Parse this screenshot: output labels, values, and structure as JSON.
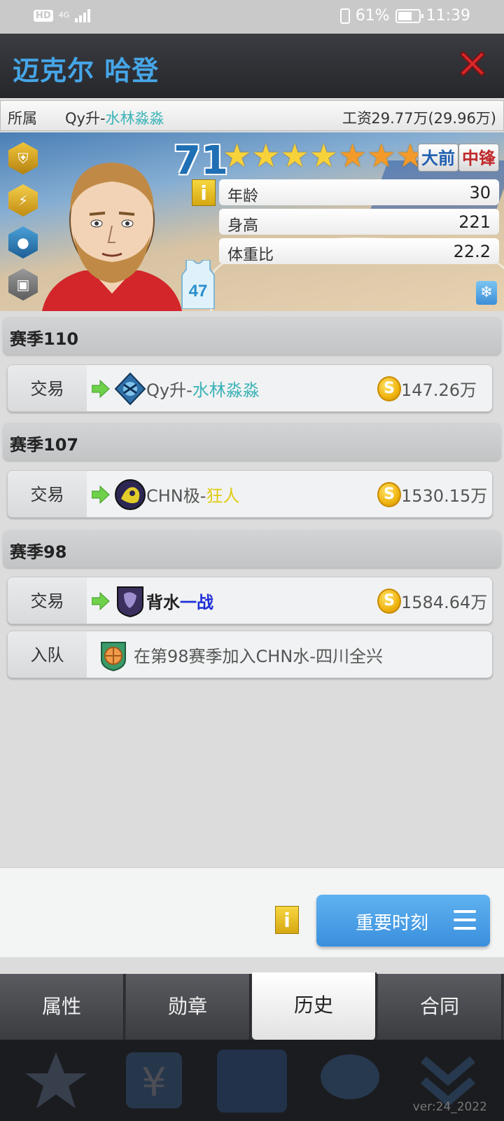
{
  "status_bar": {
    "hd": "HD",
    "network": "4G",
    "battery": "61%",
    "time": "11:39"
  },
  "header": {
    "player_name": "迈克尔 哈登"
  },
  "info_bar": {
    "team_label": "所属",
    "team_prefix": "Qy升-",
    "team_name": "水林淼淼",
    "salary_label": "工资",
    "salary_value": "29.77万(29.96万)"
  },
  "player_card": {
    "overall": "71",
    "stars": {
      "gold": 4,
      "orange": 3
    },
    "positions": [
      "大前",
      "中锋"
    ],
    "info_icon": "i",
    "jersey_number": "47",
    "stats": [
      {
        "label": "年龄",
        "value": "30"
      },
      {
        "label": "身高",
        "value": "221"
      },
      {
        "label": "体重比",
        "value": "22.2"
      }
    ],
    "badges": [
      "shield-badge-icon",
      "lightning-badge-icon",
      "basketball-badge-icon",
      "lock-badge-icon"
    ],
    "snow_icon": "❄"
  },
  "history": [
    {
      "season": "赛季110",
      "events": [
        {
          "type": "交易",
          "team_prefix": "Qy升-",
          "team_name": "水林淼淼",
          "price": "147.26万"
        }
      ]
    },
    {
      "season": "赛季107",
      "events": [
        {
          "type": "交易",
          "team_prefix": "CHN极-",
          "team_name": "狂人",
          "price": "1530.15万"
        }
      ]
    },
    {
      "season": "赛季98",
      "events": [
        {
          "type": "交易",
          "team_prefix": "背水",
          "team_name": "一战",
          "price": "1584.64万"
        },
        {
          "type": "入队",
          "description": "在第98赛季加入CHN水-四川全兴"
        }
      ]
    }
  ],
  "coin_symbol": "S",
  "bottom": {
    "info": "i",
    "moments_button": "重要时刻"
  },
  "tabs": [
    {
      "label": "属性",
      "active": false
    },
    {
      "label": "勋章",
      "active": false
    },
    {
      "label": "历史",
      "active": true
    },
    {
      "label": "合同",
      "active": false
    }
  ],
  "version": "ver:24_2022",
  "colors": {
    "accent_blue": "#46a6e8",
    "teal": "#3bb3b8",
    "close_red": "#d8282a"
  }
}
